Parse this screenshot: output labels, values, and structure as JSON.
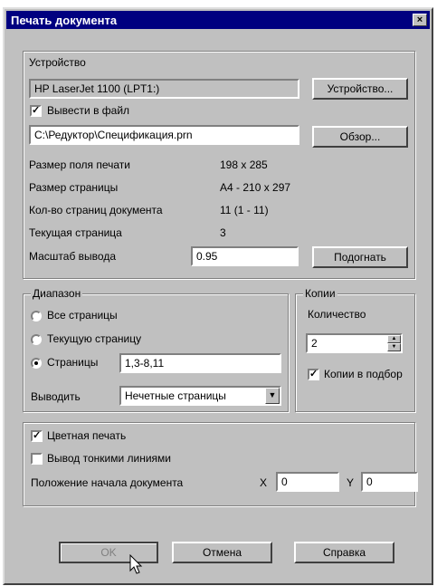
{
  "window": {
    "title": "Печать документа",
    "close_label": "×"
  },
  "device": {
    "group_label": "Устройство",
    "printer_name": "HP LaserJet 1100 (LPT1:)",
    "device_button": "Устройство...",
    "output_to_file_label": "Вывести в файл",
    "output_to_file_checked": true,
    "file_path": "C:\\Редуктор\\Спецификация.prn",
    "browse_button": "Обзор...",
    "info": [
      {
        "label": "Размер поля печати",
        "value": "198 x 285"
      },
      {
        "label": "Размер страницы",
        "value": "A4 - 210 x 297"
      },
      {
        "label": "Кол-во страниц документа",
        "value": "11 (1 - 11)"
      },
      {
        "label": "Текущая страница",
        "value": "3"
      }
    ],
    "scale_label": "Масштаб вывода",
    "scale_value": "0.95",
    "fit_button": "Подогнать"
  },
  "range": {
    "group_label": "Диапазон",
    "all_pages": "Все страницы",
    "current_page": "Текущую страницу",
    "pages": "Страницы",
    "pages_value": "1,3-8,11",
    "selected": "pages",
    "output_label": "Выводить",
    "output_value": "Нечетные страницы"
  },
  "copies": {
    "group_label": "Копии",
    "count_label": "Количество",
    "count_value": "2",
    "collate_label": "Копии в подбор",
    "collate_checked": true
  },
  "options": {
    "color_print_label": "Цветная печать",
    "color_print_checked": true,
    "thin_lines_label": "Вывод тонкими линиями",
    "thin_lines_checked": false,
    "origin_label": "Положение начала документа",
    "x_label": "X",
    "x_value": "0",
    "y_label": "Y",
    "y_value": "0"
  },
  "buttons": {
    "ok": "OK",
    "cancel": "Отмена",
    "help": "Справка"
  }
}
